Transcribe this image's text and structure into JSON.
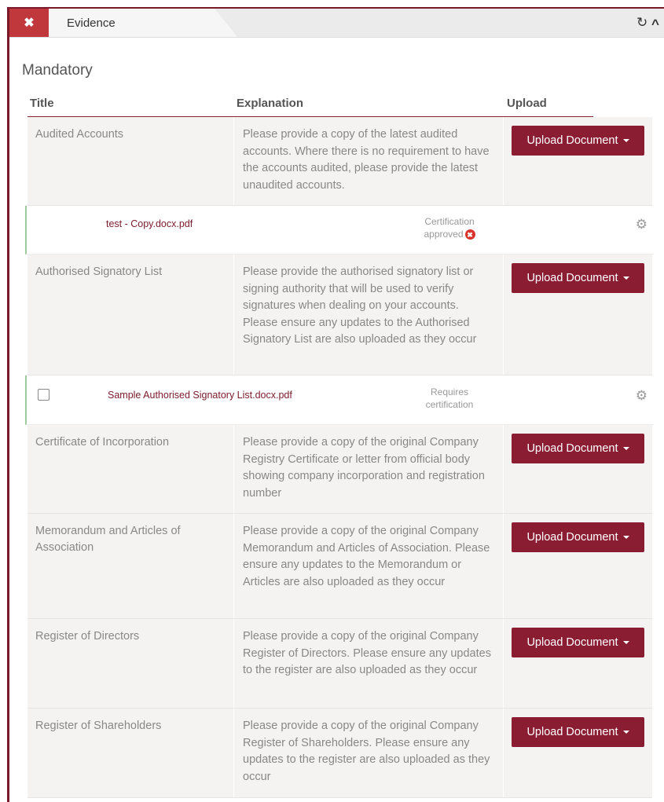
{
  "header": {
    "close_glyph": "✖",
    "title": "Evidence",
    "refresh_glyph": "↻",
    "collapse_glyph": "^"
  },
  "section": {
    "title": "Mandatory"
  },
  "columns": {
    "title": "Title",
    "explanation": "Explanation",
    "upload": "Upload"
  },
  "upload_label": "Upload Document",
  "rows": [
    {
      "title": "Audited Accounts",
      "explanation": "Please provide a copy of the latest audited accounts. Where there is no requirement to have the accounts audited, please provide the latest unaudited accounts."
    },
    {
      "title": "Authorised Signatory List",
      "explanation": "Please provide the authorised signatory list or signing authority that will be used to verify signatures when dealing on your accounts. Please ensure any updates to the Authorised Signatory List are also uploaded as they occur"
    },
    {
      "title": "Certificate of Incorporation",
      "explanation": "Please provide a copy of the original Company Registry Certificate or letter from official body showing company incorporation and registration number"
    },
    {
      "title": "Memorandum and Articles of Association",
      "explanation": "Please provide a copy of the original Company Memorandum and Articles of Association. Please ensure any updates to the Memorandum or Articles are also uploaded as they occur"
    },
    {
      "title": "Register of Directors",
      "explanation": "Please provide a copy of the original Company Register of Directors. Please ensure any updates to the register are also uploaded as they occur"
    },
    {
      "title": "Register of Shareholders",
      "explanation": "Please provide a copy of the original Company Register of Shareholders. Please ensure any updates to the register are also uploaded as they occur"
    }
  ],
  "files": [
    {
      "name": "test - Copy.docx.pdf",
      "status_line1": "Certification",
      "status_line2": "approved",
      "status_icon": "✖"
    },
    {
      "name": "Sample Authorised Signatory List.docx.pdf",
      "status_line1": "Requires",
      "status_line2": "certification"
    }
  ],
  "gear_glyph": "⚙"
}
